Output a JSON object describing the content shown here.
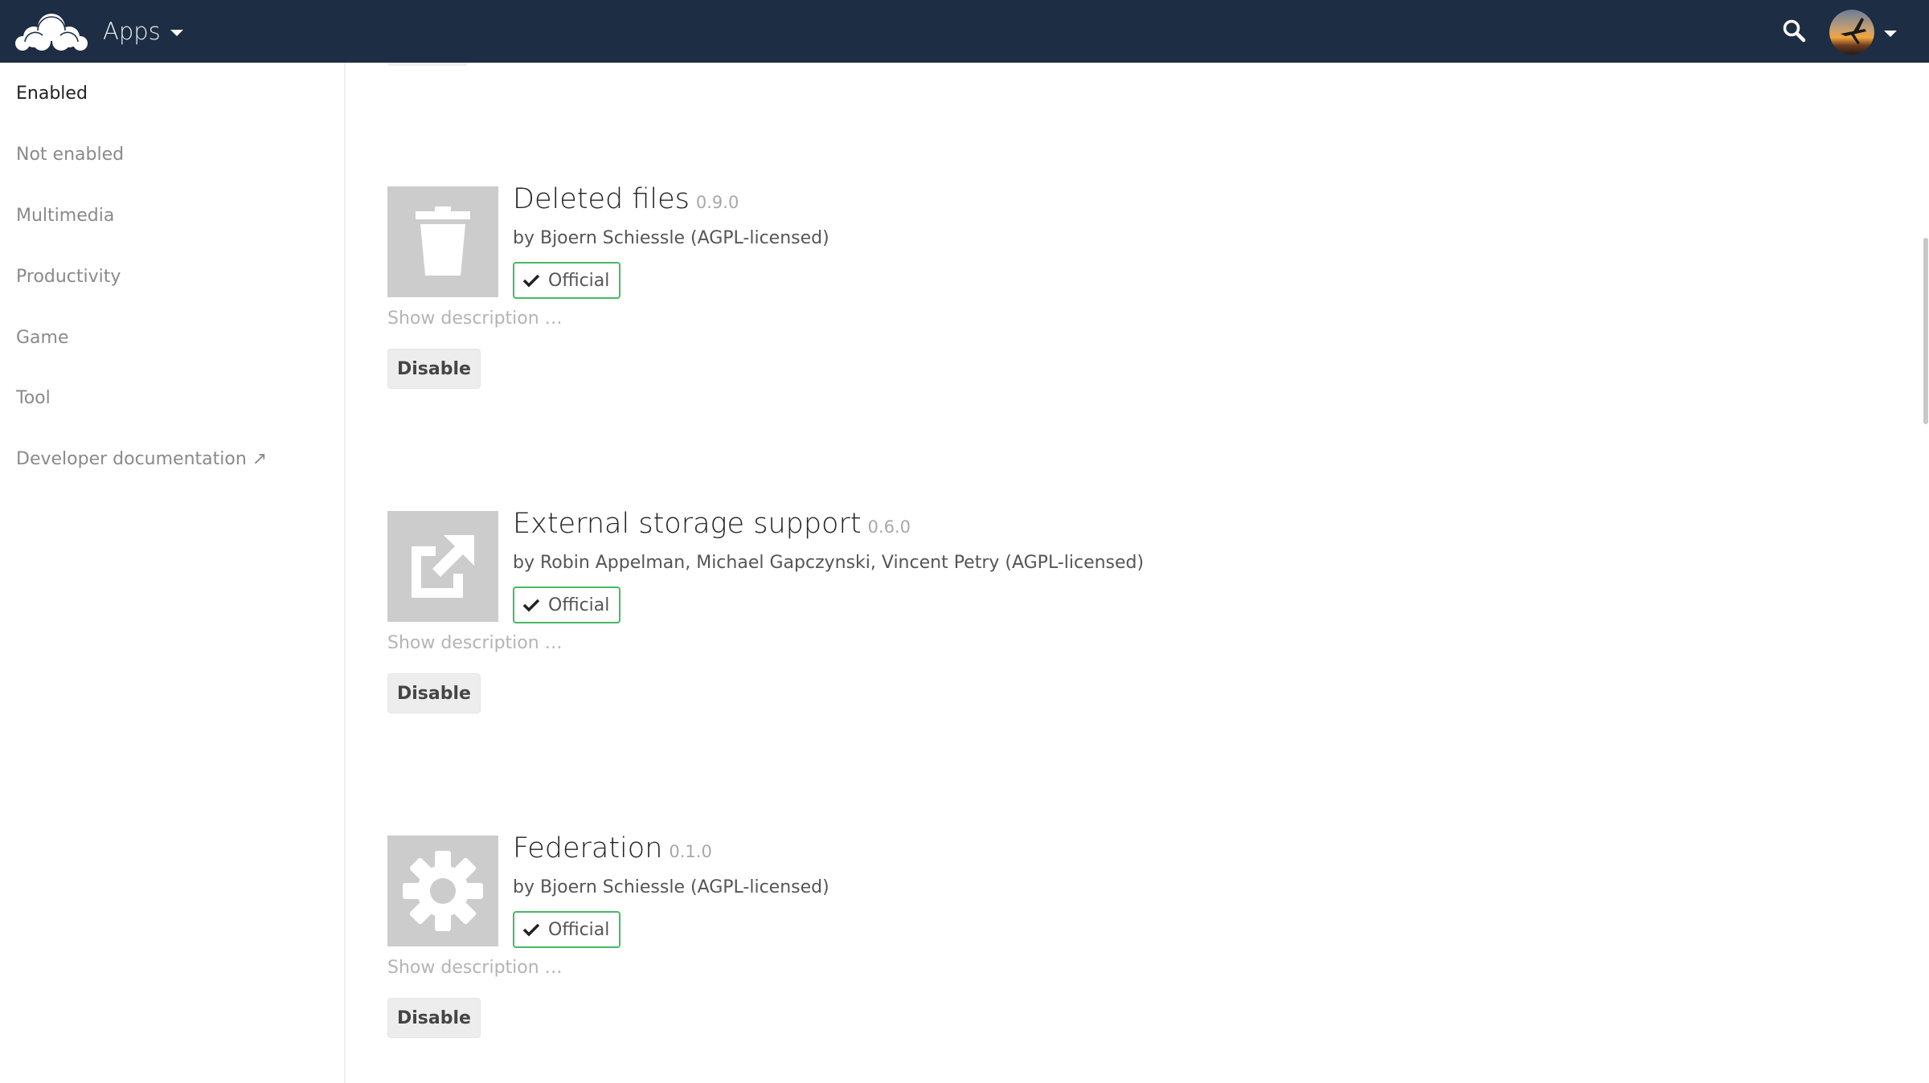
{
  "header": {
    "app_menu_label": "Apps"
  },
  "sidebar": {
    "items": [
      {
        "label": "Enabled",
        "active": true
      },
      {
        "label": "Not enabled"
      },
      {
        "label": "Multimedia"
      },
      {
        "label": "Productivity"
      },
      {
        "label": "Game"
      },
      {
        "label": "Tool"
      },
      {
        "label": "Developer documentation ↗"
      }
    ]
  },
  "apps": [
    {
      "name": "Deleted files",
      "version": "0.9.0",
      "author": "by Bjoern Schiessle (AGPL-licensed)",
      "badge": "Official",
      "show_description": "Show description …",
      "button": "Disable",
      "icon": "trash-icon"
    },
    {
      "name": "External storage support",
      "version": "0.6.0",
      "author": "by Robin Appelman, Michael Gapczynski, Vincent Petry (AGPL-licensed)",
      "badge": "Official",
      "show_description": "Show description …",
      "button": "Disable",
      "icon": "external-link-icon"
    },
    {
      "name": "Federation",
      "version": "0.1.0",
      "author": "by Bjoern Schiessle (AGPL-licensed)",
      "badge": "Official",
      "show_description": "Show description …",
      "button": "Disable",
      "icon": "gear-icon"
    }
  ],
  "colors": {
    "header_bg": "#1d2d44",
    "official_green": "#46ba61",
    "icon_bg": "#cccccc"
  }
}
